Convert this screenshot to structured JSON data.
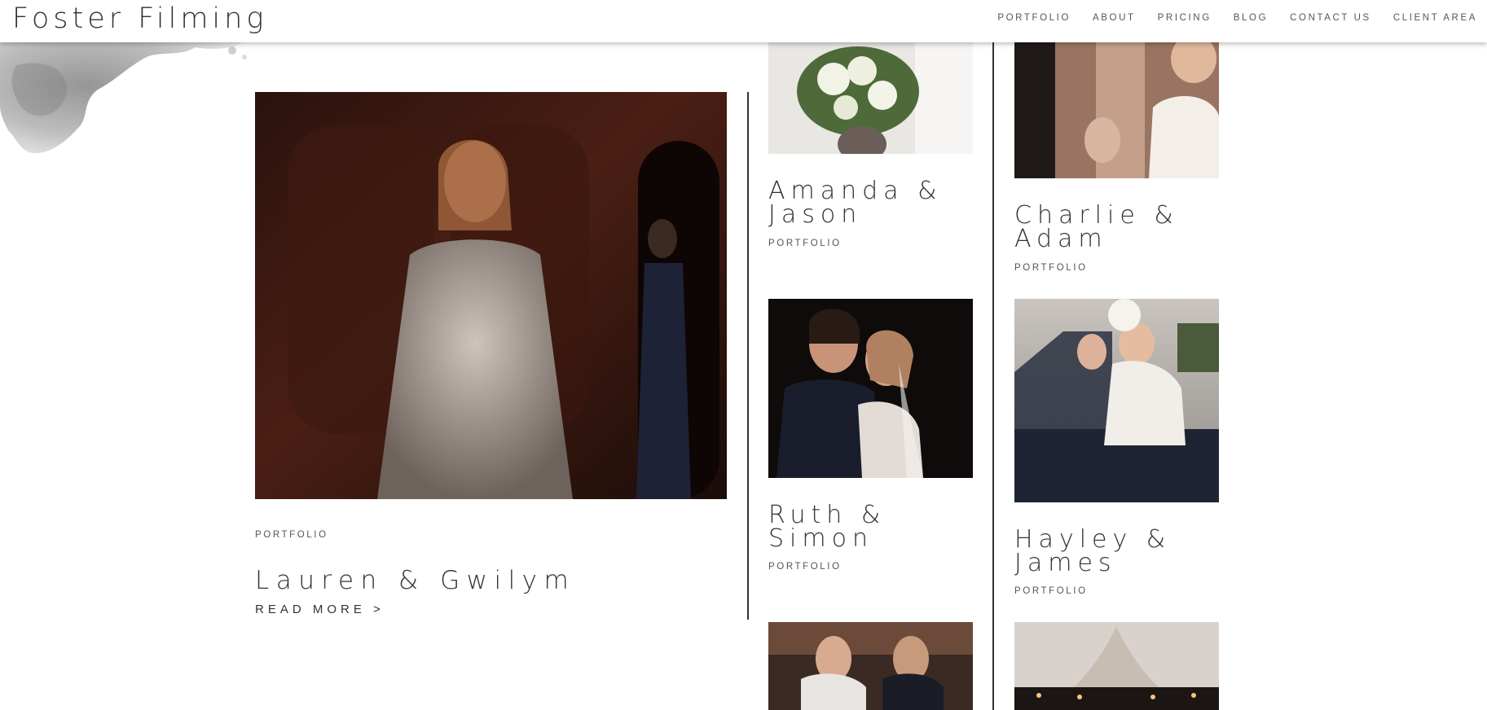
{
  "site": {
    "logo": "Foster Filming"
  },
  "nav": [
    "PORTFOLIO",
    "ABOUT",
    "PRICING",
    "BLOG",
    "CONTACT US",
    "CLIENT AREA"
  ],
  "featured": {
    "category": "PORTFOLIO",
    "title": "Lauren & Gwilym",
    "read_more": "READ MORE >"
  },
  "grid": {
    "col1": [
      {
        "title_line1": "Amanda &",
        "title_line2": "Jason",
        "category": "PORTFOLIO"
      },
      {
        "title_line1": "Ruth &",
        "title_line2": "Simon",
        "category": "PORTFOLIO"
      }
    ],
    "col2": [
      {
        "title_line1": "Charlie &",
        "title_line2": "Adam",
        "category": "PORTFOLIO"
      },
      {
        "title_line1": "Hayley &",
        "title_line2": "James",
        "category": "PORTFOLIO"
      }
    ]
  },
  "colors": {
    "text": "#333333",
    "background": "#ffffff",
    "divider": "#333333"
  }
}
